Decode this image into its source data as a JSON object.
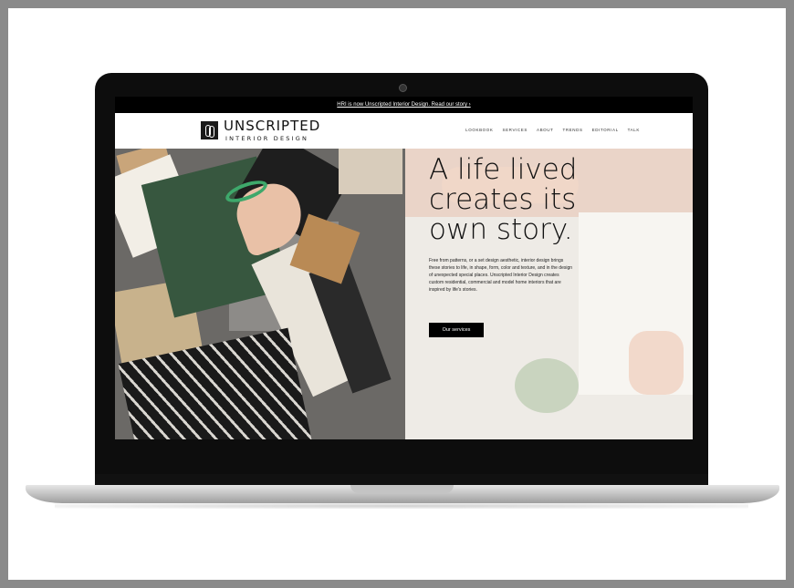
{
  "announcement": {
    "text": "HRI is now Unscripted Interior Design. Read our story ›"
  },
  "brand": {
    "name": "UNSCRIPTED",
    "tagline": "INTERIOR DESIGN"
  },
  "nav": {
    "items": [
      {
        "label": "LOOKBOOK"
      },
      {
        "label": "SERVICES"
      },
      {
        "label": "ABOUT"
      },
      {
        "label": "TRENDS"
      },
      {
        "label": "EDITORIAL"
      },
      {
        "label": "TALK"
      }
    ]
  },
  "hero": {
    "headline": "A life lived creates its own story.",
    "body": "Free from patterns, or a set design aesthetic, interior design brings these stories to life, in shape, form, color and texture, and in the design of unexpected special places. Unscripted Interior Design creates custom residential, commercial and model home interiors that are inspired by life's stories.",
    "cta": "Our services"
  },
  "colors": {
    "accent": "#000000",
    "bracelet": "#3ea86b"
  }
}
